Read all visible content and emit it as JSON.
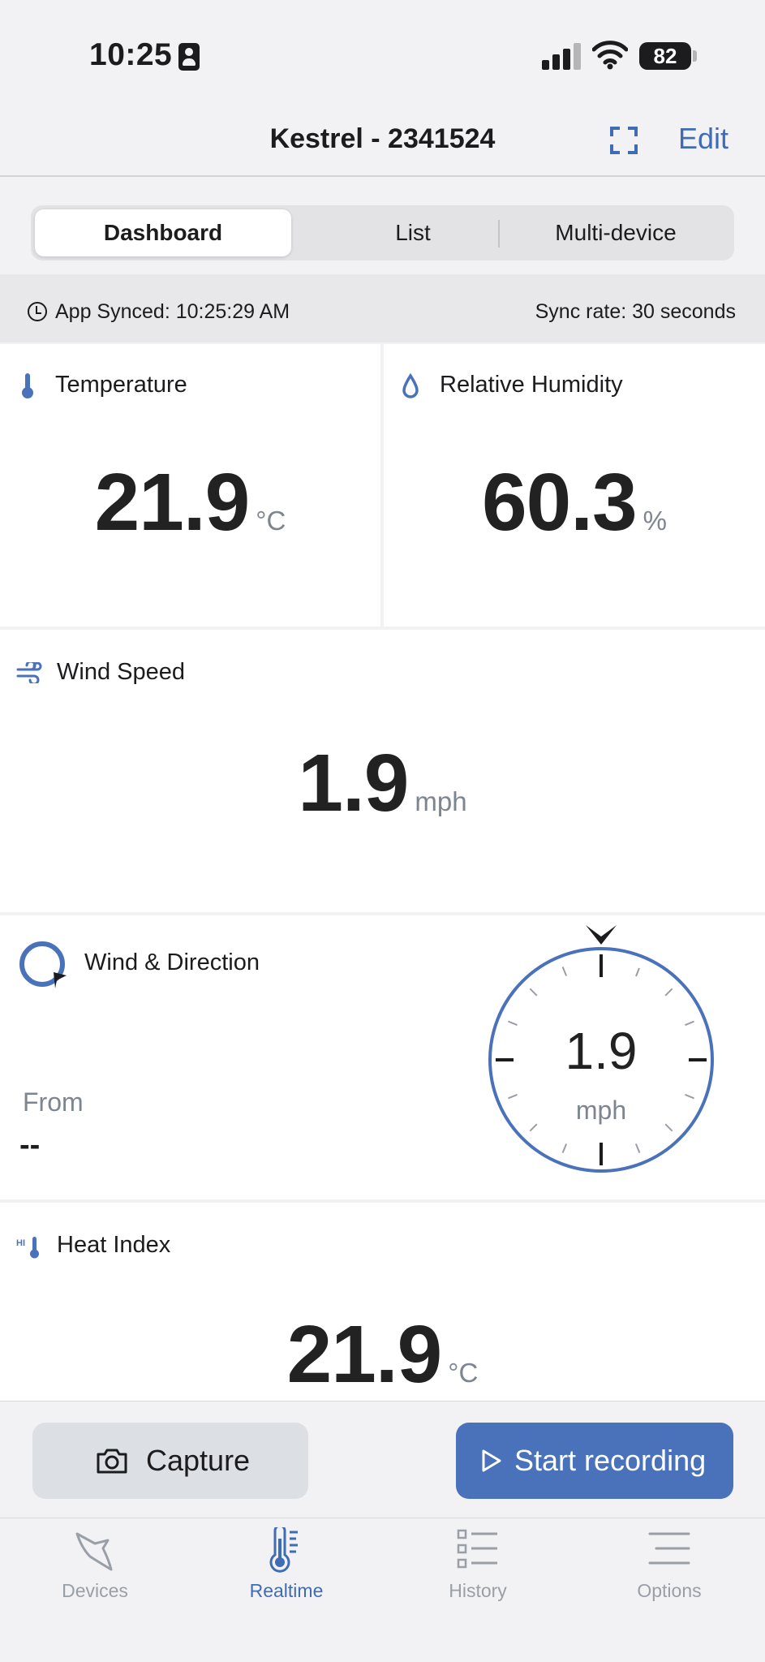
{
  "status_bar": {
    "time": "10:25",
    "battery": "82"
  },
  "nav": {
    "title": "Kestrel - 2341524",
    "edit_label": "Edit"
  },
  "tabs_segment": {
    "items": [
      "Dashboard",
      "List",
      "Multi-device"
    ],
    "selected": "Dashboard"
  },
  "sync": {
    "synced_text": "App Synced: 10:25:29 AM",
    "rate_text": "Sync rate: 30 seconds"
  },
  "cards": {
    "temperature": {
      "title": "Temperature",
      "value": "21.9",
      "unit": "°C"
    },
    "humidity": {
      "title": "Relative Humidity",
      "value": "60.3",
      "unit": "%"
    },
    "wind_speed": {
      "title": "Wind Speed",
      "value": "1.9",
      "unit": "mph"
    },
    "wind_direction": {
      "title": "Wind & Direction",
      "from_label": "From",
      "from_value": "--",
      "compass_value": "1.9",
      "compass_unit": "mph"
    },
    "heat_index": {
      "title": "Heat Index",
      "value": "21.9",
      "unit": "°C"
    }
  },
  "actions": {
    "capture_label": "Capture",
    "record_label": "Start recording"
  },
  "tab_bar": {
    "items": [
      {
        "label": "Devices",
        "icon": "bird-icon"
      },
      {
        "label": "Realtime",
        "icon": "thermometer-icon"
      },
      {
        "label": "History",
        "icon": "list-icon"
      },
      {
        "label": "Options",
        "icon": "menu-icon"
      }
    ],
    "active": "Realtime"
  },
  "colors": {
    "accent": "#3f6db5",
    "button_primary": "#4a72bb",
    "background": "#f2f2f4",
    "card": "#ffffff",
    "muted_text": "#7d8591"
  }
}
